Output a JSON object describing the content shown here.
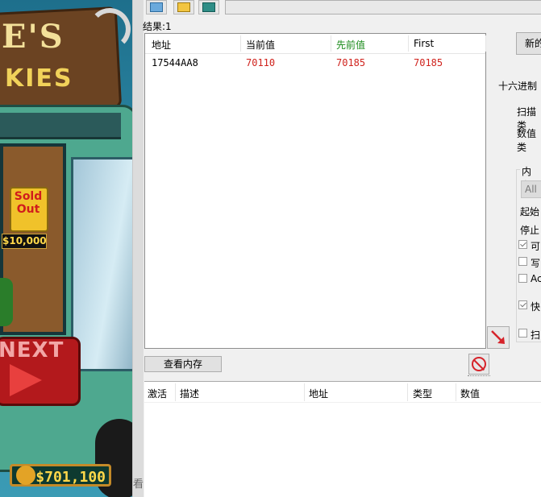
{
  "game": {
    "sign_line1": "E'S",
    "sign_line2": "KIES",
    "sold_out": "Sold Out",
    "price_tag": "$10,000",
    "next_label": "NEXT",
    "money": "$701,100"
  },
  "divider_char": "看",
  "results": {
    "count_label": "结果:1",
    "columns": [
      "地址",
      "当前值",
      "先前值",
      "First"
    ],
    "column_colors": {
      "previous": "#1a8a1a",
      "current_value_text": "#d0231d"
    },
    "rows": [
      {
        "address": "17544AA8",
        "current": "70110",
        "previous": "70185",
        "first": "70185"
      }
    ]
  },
  "right_panel": {
    "first_scan_button": "新的",
    "hex_label": "十六进制",
    "scan_type_label": "扫描类",
    "value_type_label": "数值类",
    "memory_group_title": "内存",
    "memory_region": "All",
    "start_label": "起始",
    "stop_label": "停止",
    "checkboxes": [
      {
        "label": "可",
        "checked": true
      },
      {
        "label": "写",
        "checked": false
      },
      {
        "label": "Ac",
        "checked": false
      },
      {
        "label": "快",
        "checked": true
      },
      {
        "label": "扫",
        "checked": false
      }
    ]
  },
  "buttons": {
    "view_memory": "查看内存"
  },
  "address_list": {
    "columns": [
      "激活",
      "描述",
      "地址",
      "类型",
      "数值"
    ]
  }
}
